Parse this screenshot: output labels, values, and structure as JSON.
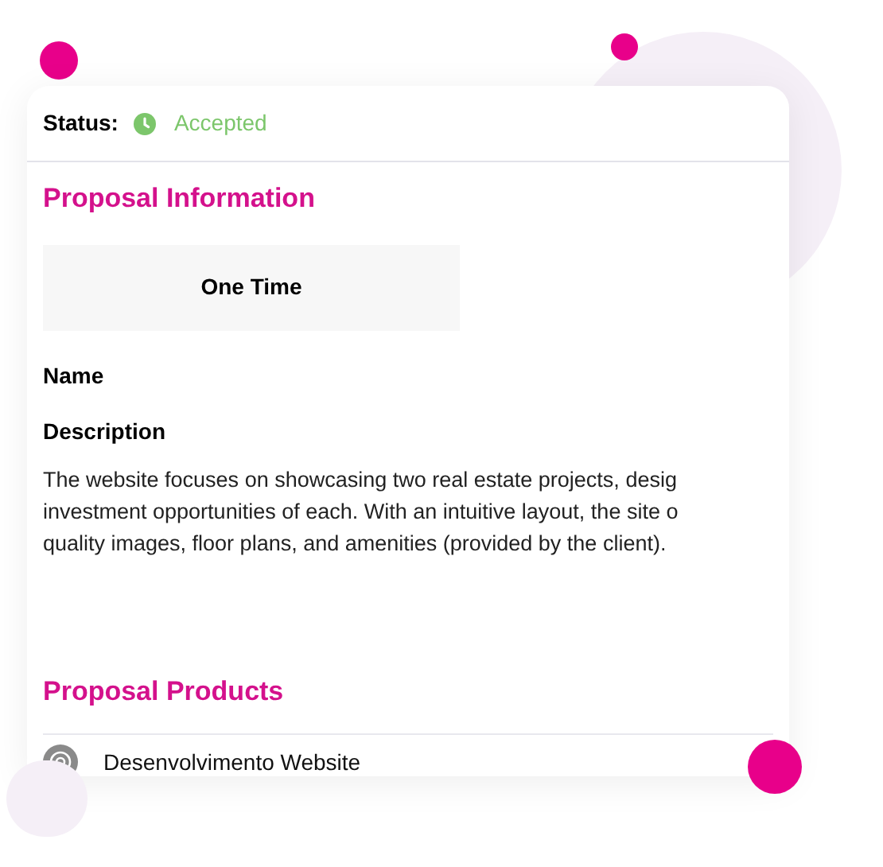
{
  "status": {
    "label": "Status:",
    "value": "Accepted",
    "color": "#7cc66b"
  },
  "proposal_information": {
    "title": "Proposal Information",
    "type_tab": {
      "label": "One Time"
    },
    "name_label": "Name",
    "description_label": "Description",
    "description_lines": [
      "The website focuses on showcasing two real estate projects, desig",
      "investment opportunities of each. With an intuitive layout, the site o",
      "quality images, floor plans, and amenities (provided by the client)."
    ]
  },
  "proposal_products": {
    "title": "Proposal Products",
    "items": [
      {
        "name": "Desenvolvimento Website"
      }
    ]
  }
}
